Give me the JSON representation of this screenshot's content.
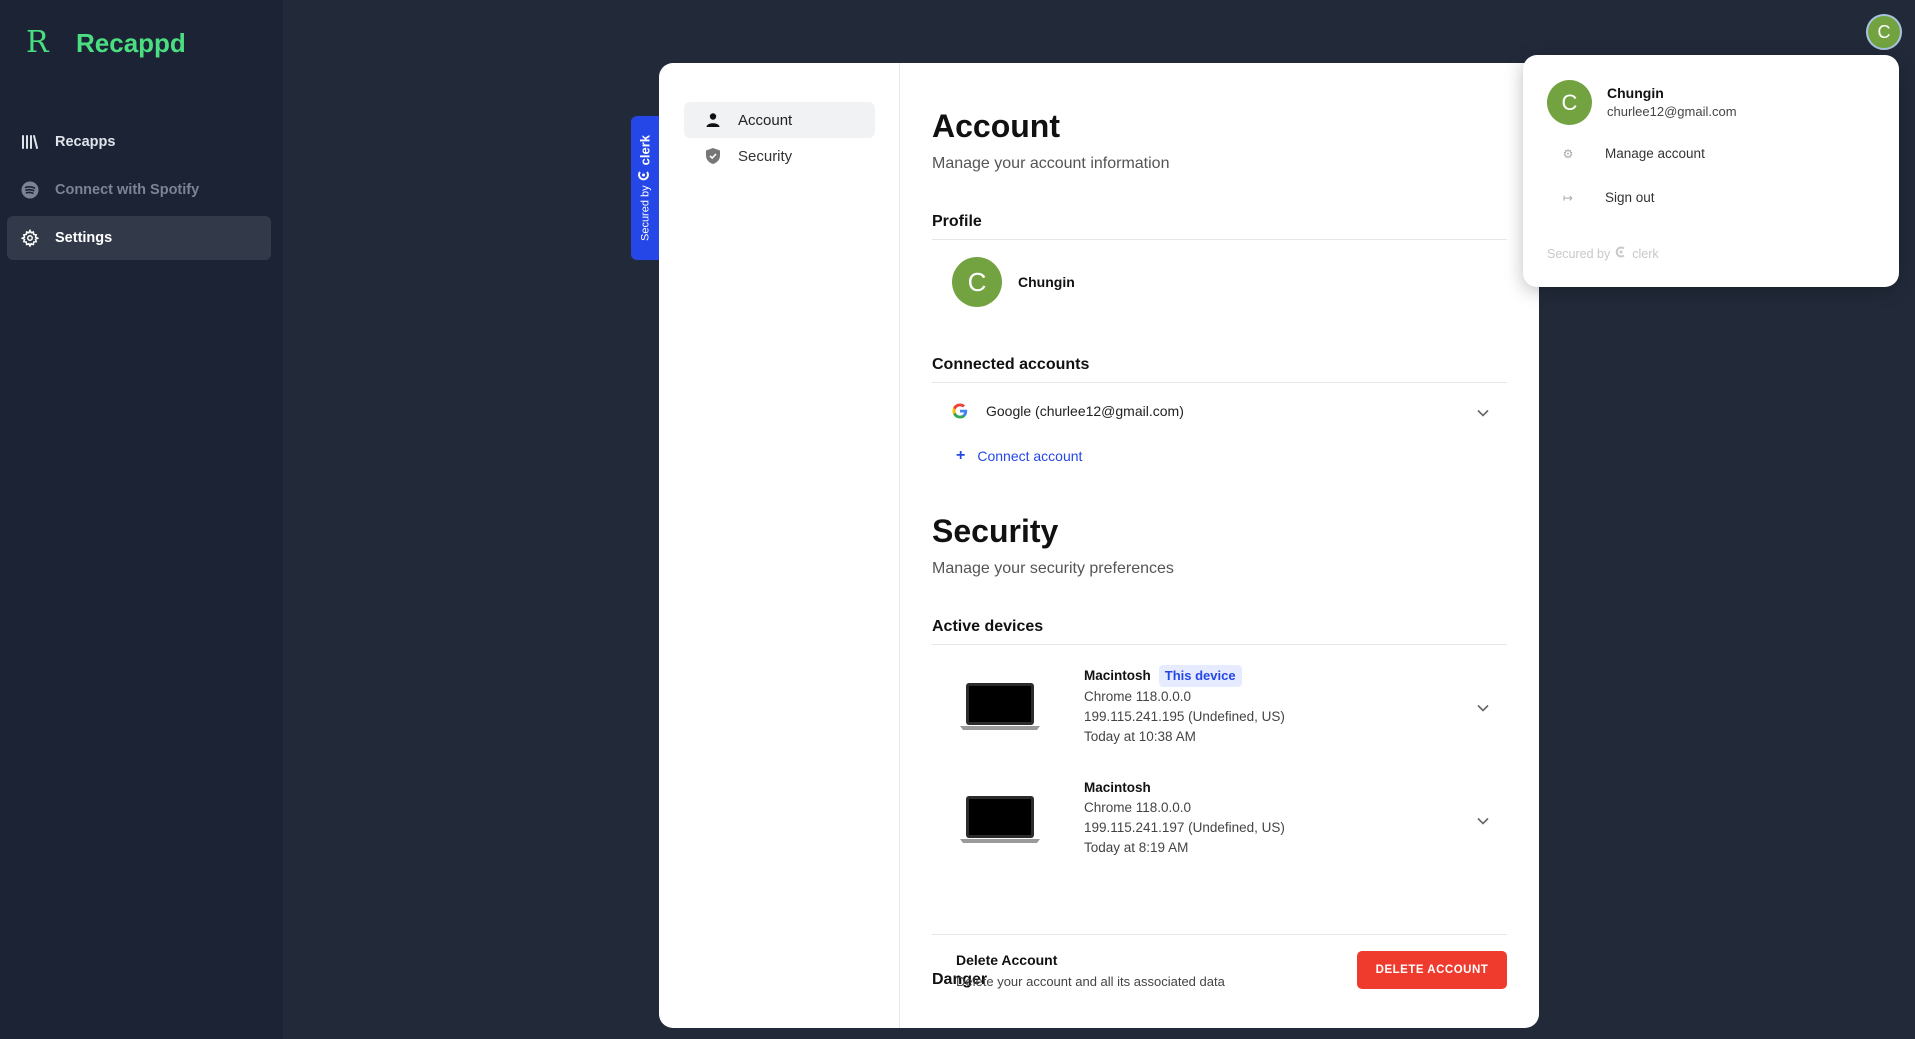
{
  "app": {
    "name": "Recappd",
    "logo_glyph": "R"
  },
  "sidebar": {
    "items": [
      {
        "label": "Recapps",
        "icon": "library-icon"
      },
      {
        "label": "Connect with Spotify",
        "icon": "spotify-icon"
      },
      {
        "label": "Settings",
        "icon": "gear-icon"
      }
    ]
  },
  "user": {
    "initial": "C",
    "name": "Chungin",
    "email": "churlee12@gmail.com",
    "avatar_color": "#72a340"
  },
  "clerk_badge": {
    "prefix": "Secured by",
    "brand": "clerk"
  },
  "card_nav": {
    "items": [
      {
        "label": "Account",
        "icon": "person-icon"
      },
      {
        "label": "Security",
        "icon": "shield-icon"
      }
    ]
  },
  "account": {
    "title": "Account",
    "subtitle": "Manage your account information",
    "profile_title": "Profile",
    "connected_title": "Connected accounts",
    "connected": [
      {
        "provider": "Google (churlee12@gmail.com)"
      }
    ],
    "connect_label": "Connect account"
  },
  "security": {
    "title": "Security",
    "subtitle": "Manage your security preferences",
    "devices_title": "Active devices",
    "devices": [
      {
        "name": "Macintosh",
        "badge": "This device",
        "browser": "Chrome 118.0.0.0",
        "ip": "199.115.241.195 (Undefined, US)",
        "time": "Today at 10:38 AM"
      },
      {
        "name": "Macintosh",
        "badge": "",
        "browser": "Chrome 118.0.0.0",
        "ip": "199.115.241.197 (Undefined, US)",
        "time": "Today at 8:19 AM"
      }
    ],
    "danger_title": "Danger",
    "delete_title": "Delete Account",
    "delete_sub": "Delete your account and all its associated data",
    "delete_button": "DELETE ACCOUNT"
  },
  "popover": {
    "manage_label": "Manage account",
    "signout_label": "Sign out",
    "secured_prefix": "Secured by",
    "secured_brand": "clerk"
  },
  "colors": {
    "accent": "#4ade80",
    "clerk_blue": "#2547e8",
    "danger": "#ef3b2d",
    "bg": "#222a3a",
    "sidebar": "#1b2335"
  }
}
